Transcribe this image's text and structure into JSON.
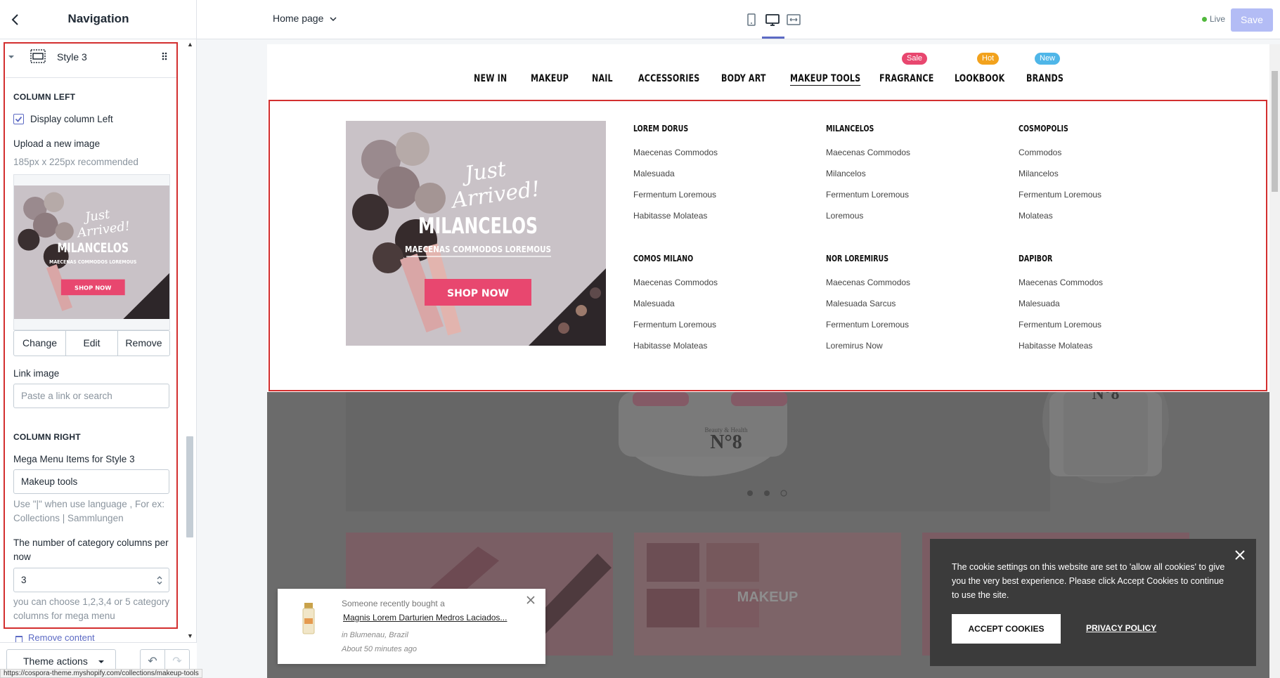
{
  "sidebar": {
    "title": "Navigation",
    "section_row_label": "Style 3",
    "column_left": {
      "heading": "COLUMN LEFT",
      "display_checkbox_label": "Display column Left",
      "display_checked": true,
      "upload_label": "Upload a new image",
      "upload_hint": "185px x 225px recommended",
      "image_buttons": [
        "Change",
        "Edit",
        "Remove"
      ],
      "link_label": "Link image",
      "link_placeholder": "Paste a link or search"
    },
    "column_right": {
      "heading": "COLUMN RIGHT",
      "items_label": "Mega Menu Items for Style 3",
      "items_value": "Makeup tools",
      "items_hint": "Use \"|\" when use language , For ex: Collections | Sammlungen",
      "columns_label": "The number of category columns per now",
      "columns_value": "3",
      "columns_hint": "you can choose 1,2,3,4 or 5 category columns for mega menu"
    },
    "remove_content_label": "Remove content",
    "theme_actions_label": "Theme actions"
  },
  "status_url": "https://cospora-theme.myshopify.com/collections/makeup-tools",
  "topbar": {
    "page_select": "Home page",
    "live_label": "Live",
    "save_label": "Save"
  },
  "store_nav": {
    "items": [
      "NEW IN",
      "MAKEUP",
      "NAIL",
      "ACCESSORIES",
      "BODY ART",
      "MAKEUP TOOLS",
      "FRAGRANCE",
      "LOOKBOOK",
      "BRANDS"
    ],
    "active": "MAKEUP TOOLS",
    "badges": {
      "sale": {
        "label": "Sale",
        "color": "#e8476f"
      },
      "hot": {
        "label": "Hot",
        "color": "#f2a21d"
      },
      "new": {
        "label": "New",
        "color": "#4fb6e8"
      }
    }
  },
  "banner": {
    "script_line1": "Just",
    "script_line2": "Arrived!",
    "headline": "MILANCELOS",
    "subline": "MAECENAS COMMODOS LOREMOUS",
    "cta": "SHOP NOW",
    "cta_color": "#e8476f"
  },
  "mega_menu": {
    "columns": [
      {
        "heading": "LOREM DORUS",
        "links": [
          "Maecenas Commodos",
          "Malesuada",
          "Fermentum Loremous",
          "Habitasse Molateas"
        ]
      },
      {
        "heading": "MILANCELOS",
        "links": [
          "Maecenas Commodos",
          "Milancelos",
          "Fermentum Loremous",
          "Loremous"
        ]
      },
      {
        "heading": "COSMOPOLIS",
        "links": [
          "Commodos",
          "Milancelos",
          "Fermentum Loremous",
          "Molateas"
        ]
      },
      {
        "heading": "COMOS MILANO",
        "links": [
          "Maecenas Commodos",
          "Malesuada",
          "Fermentum Loremous",
          "Habitasse Molateas"
        ]
      },
      {
        "heading": "NOR LOREMIRUS",
        "links": [
          "Maecenas Commodos",
          "Malesuada Sarcus",
          "Fermentum Loremous",
          "Loremirus Now"
        ]
      },
      {
        "heading": "DAPIBOR",
        "links": [
          "Maecenas Commodos",
          "Malesuada",
          "Fermentum Loremous",
          "Habitasse Molateas"
        ]
      }
    ]
  },
  "background_content": {
    "product_brand_text": "Beauty & Health",
    "product_label": "N°8",
    "tile_label": "MAKEUP"
  },
  "cookie_banner": {
    "text": "The cookie settings on this website are set to 'allow all cookies' to give you the very best experience. Please click Accept Cookies to continue to use the site.",
    "accept_label": "ACCEPT COOKIES",
    "privacy_label": "PRIVACY POLICY"
  },
  "purchase_popup": {
    "line1": "Someone recently bought a",
    "product": "Magnis Lorem Darturien Medros Laciados...",
    "location": "in Blumenau, Brazil",
    "time": "About 50 minutes ago"
  }
}
